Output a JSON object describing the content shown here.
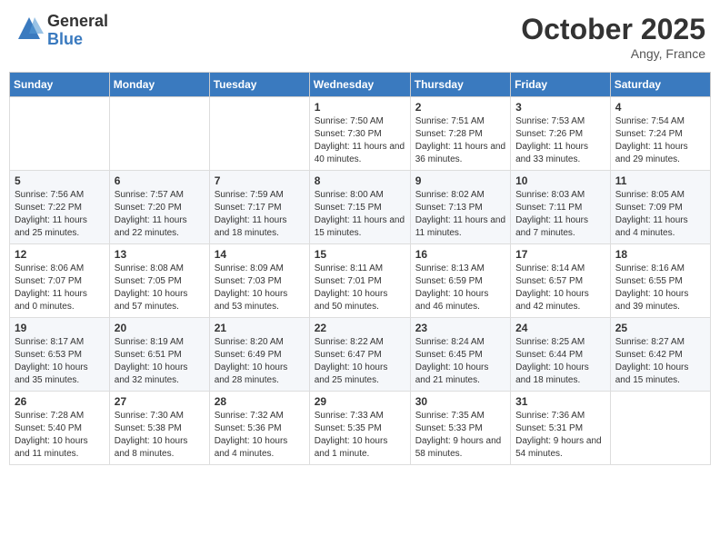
{
  "header": {
    "logo_general": "General",
    "logo_blue": "Blue",
    "month_title": "October 2025",
    "location": "Angy, France"
  },
  "weekdays": [
    "Sunday",
    "Monday",
    "Tuesday",
    "Wednesday",
    "Thursday",
    "Friday",
    "Saturday"
  ],
  "weeks": [
    [
      {
        "day": "",
        "info": ""
      },
      {
        "day": "",
        "info": ""
      },
      {
        "day": "",
        "info": ""
      },
      {
        "day": "1",
        "info": "Sunrise: 7:50 AM\nSunset: 7:30 PM\nDaylight: 11 hours\nand 40 minutes."
      },
      {
        "day": "2",
        "info": "Sunrise: 7:51 AM\nSunset: 7:28 PM\nDaylight: 11 hours\nand 36 minutes."
      },
      {
        "day": "3",
        "info": "Sunrise: 7:53 AM\nSunset: 7:26 PM\nDaylight: 11 hours\nand 33 minutes."
      },
      {
        "day": "4",
        "info": "Sunrise: 7:54 AM\nSunset: 7:24 PM\nDaylight: 11 hours\nand 29 minutes."
      }
    ],
    [
      {
        "day": "5",
        "info": "Sunrise: 7:56 AM\nSunset: 7:22 PM\nDaylight: 11 hours\nand 25 minutes."
      },
      {
        "day": "6",
        "info": "Sunrise: 7:57 AM\nSunset: 7:20 PM\nDaylight: 11 hours\nand 22 minutes."
      },
      {
        "day": "7",
        "info": "Sunrise: 7:59 AM\nSunset: 7:17 PM\nDaylight: 11 hours\nand 18 minutes."
      },
      {
        "day": "8",
        "info": "Sunrise: 8:00 AM\nSunset: 7:15 PM\nDaylight: 11 hours\nand 15 minutes."
      },
      {
        "day": "9",
        "info": "Sunrise: 8:02 AM\nSunset: 7:13 PM\nDaylight: 11 hours\nand 11 minutes."
      },
      {
        "day": "10",
        "info": "Sunrise: 8:03 AM\nSunset: 7:11 PM\nDaylight: 11 hours\nand 7 minutes."
      },
      {
        "day": "11",
        "info": "Sunrise: 8:05 AM\nSunset: 7:09 PM\nDaylight: 11 hours\nand 4 minutes."
      }
    ],
    [
      {
        "day": "12",
        "info": "Sunrise: 8:06 AM\nSunset: 7:07 PM\nDaylight: 11 hours\nand 0 minutes."
      },
      {
        "day": "13",
        "info": "Sunrise: 8:08 AM\nSunset: 7:05 PM\nDaylight: 10 hours\nand 57 minutes."
      },
      {
        "day": "14",
        "info": "Sunrise: 8:09 AM\nSunset: 7:03 PM\nDaylight: 10 hours\nand 53 minutes."
      },
      {
        "day": "15",
        "info": "Sunrise: 8:11 AM\nSunset: 7:01 PM\nDaylight: 10 hours\nand 50 minutes."
      },
      {
        "day": "16",
        "info": "Sunrise: 8:13 AM\nSunset: 6:59 PM\nDaylight: 10 hours\nand 46 minutes."
      },
      {
        "day": "17",
        "info": "Sunrise: 8:14 AM\nSunset: 6:57 PM\nDaylight: 10 hours\nand 42 minutes."
      },
      {
        "day": "18",
        "info": "Sunrise: 8:16 AM\nSunset: 6:55 PM\nDaylight: 10 hours\nand 39 minutes."
      }
    ],
    [
      {
        "day": "19",
        "info": "Sunrise: 8:17 AM\nSunset: 6:53 PM\nDaylight: 10 hours\nand 35 minutes."
      },
      {
        "day": "20",
        "info": "Sunrise: 8:19 AM\nSunset: 6:51 PM\nDaylight: 10 hours\nand 32 minutes."
      },
      {
        "day": "21",
        "info": "Sunrise: 8:20 AM\nSunset: 6:49 PM\nDaylight: 10 hours\nand 28 minutes."
      },
      {
        "day": "22",
        "info": "Sunrise: 8:22 AM\nSunset: 6:47 PM\nDaylight: 10 hours\nand 25 minutes."
      },
      {
        "day": "23",
        "info": "Sunrise: 8:24 AM\nSunset: 6:45 PM\nDaylight: 10 hours\nand 21 minutes."
      },
      {
        "day": "24",
        "info": "Sunrise: 8:25 AM\nSunset: 6:44 PM\nDaylight: 10 hours\nand 18 minutes."
      },
      {
        "day": "25",
        "info": "Sunrise: 8:27 AM\nSunset: 6:42 PM\nDaylight: 10 hours\nand 15 minutes."
      }
    ],
    [
      {
        "day": "26",
        "info": "Sunrise: 7:28 AM\nSunset: 5:40 PM\nDaylight: 10 hours\nand 11 minutes."
      },
      {
        "day": "27",
        "info": "Sunrise: 7:30 AM\nSunset: 5:38 PM\nDaylight: 10 hours\nand 8 minutes."
      },
      {
        "day": "28",
        "info": "Sunrise: 7:32 AM\nSunset: 5:36 PM\nDaylight: 10 hours\nand 4 minutes."
      },
      {
        "day": "29",
        "info": "Sunrise: 7:33 AM\nSunset: 5:35 PM\nDaylight: 10 hours\nand 1 minute."
      },
      {
        "day": "30",
        "info": "Sunrise: 7:35 AM\nSunset: 5:33 PM\nDaylight: 9 hours\nand 58 minutes."
      },
      {
        "day": "31",
        "info": "Sunrise: 7:36 AM\nSunset: 5:31 PM\nDaylight: 9 hours\nand 54 minutes."
      },
      {
        "day": "",
        "info": ""
      }
    ]
  ]
}
